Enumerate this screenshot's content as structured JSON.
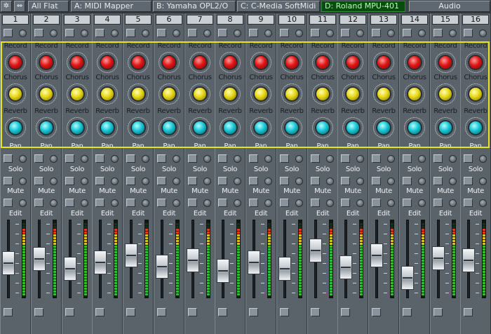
{
  "toolbar": {
    "icons": [
      "gear-icon",
      "arrows-icon"
    ],
    "all_flat_label": "All Flat",
    "ports": [
      {
        "label": "A: MIDI Mapper",
        "active": false
      },
      {
        "label": "B: Yamaha OPL2/O",
        "active": false
      },
      {
        "label": "C: C-Media SoftMidi",
        "active": false
      },
      {
        "label": "D: Roland MPU-401",
        "active": true
      }
    ],
    "audio_label": "Audio"
  },
  "labels": {
    "record": "Record",
    "chorus": "Chorus",
    "reverb": "Reverb",
    "pan": "Pan",
    "solo": "Solo",
    "mute": "Mute",
    "edit": "Edit"
  },
  "scale_labels": [
    "10",
    "5",
    "0",
    "5",
    "10",
    "20",
    "30",
    "40"
  ],
  "colors": {
    "highlight_frame": "#e6e61a",
    "active_port_bg": "#0b4a10",
    "record_knob": "#e01515",
    "chorus_knob": "#e6d615",
    "reverb_knob": "#18c4d4"
  },
  "channels": [
    {
      "number": "1",
      "fader_level": 0.42,
      "meter_level": 0.92
    },
    {
      "number": "2",
      "fader_level": 0.5,
      "meter_level": 0.92
    },
    {
      "number": "3",
      "fader_level": 0.32,
      "meter_level": 0.92
    },
    {
      "number": "4",
      "fader_level": 0.44,
      "meter_level": 0.92
    },
    {
      "number": "5",
      "fader_level": 0.56,
      "meter_level": 0.92
    },
    {
      "number": "6",
      "fader_level": 0.36,
      "meter_level": 0.92
    },
    {
      "number": "7",
      "fader_level": 0.47,
      "meter_level": 0.92
    },
    {
      "number": "8",
      "fader_level": 0.28,
      "meter_level": 0.92
    },
    {
      "number": "9",
      "fader_level": 0.44,
      "meter_level": 0.92
    },
    {
      "number": "10",
      "fader_level": 0.32,
      "meter_level": 0.92
    },
    {
      "number": "11",
      "fader_level": 0.66,
      "meter_level": 0.92
    },
    {
      "number": "12",
      "fader_level": 0.34,
      "meter_level": 0.92
    },
    {
      "number": "13",
      "fader_level": 0.56,
      "meter_level": 0.92
    },
    {
      "number": "14",
      "fader_level": 0.16,
      "meter_level": 0.92
    },
    {
      "number": "15",
      "fader_level": 0.51,
      "meter_level": 0.92
    },
    {
      "number": "16",
      "fader_level": 0.48,
      "meter_level": 0.92
    }
  ]
}
